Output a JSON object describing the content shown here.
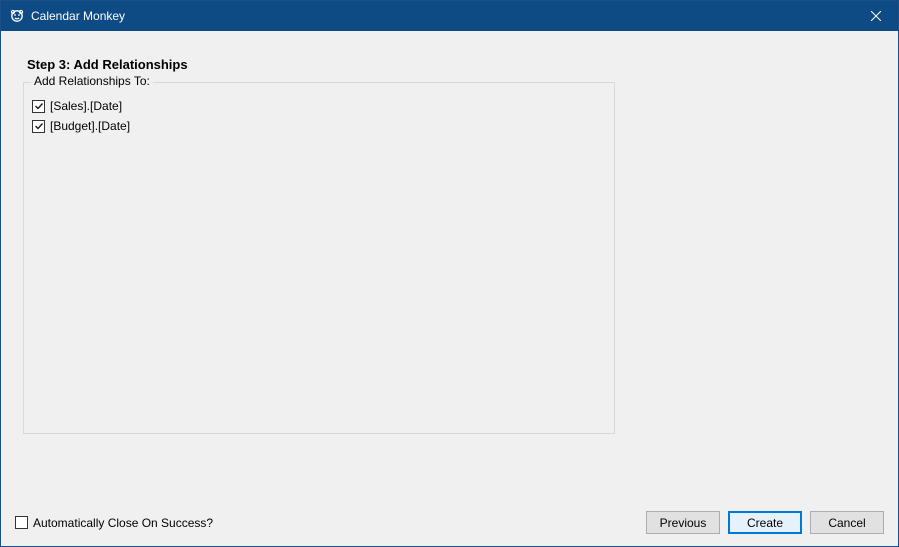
{
  "window": {
    "title": "Calendar Monkey"
  },
  "step": {
    "heading": "Step 3:  Add Relationships"
  },
  "groupbox": {
    "label": "Add Relationships To:",
    "items": [
      {
        "label": "[Sales].[Date]",
        "checked": true
      },
      {
        "label": "[Budget].[Date]",
        "checked": true
      }
    ]
  },
  "footer": {
    "auto_close_label": "Automatically Close On Success?",
    "auto_close_checked": false,
    "previous_label": "Previous",
    "create_label": "Create",
    "cancel_label": "Cancel"
  }
}
